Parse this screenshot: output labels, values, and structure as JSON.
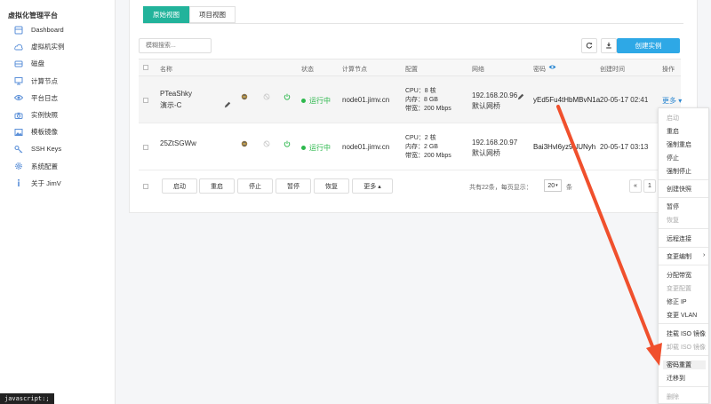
{
  "brand": "虚拟化管理平台",
  "sidebar": {
    "items": [
      {
        "label": "Dashboard",
        "icon": "dashboard-icon"
      },
      {
        "label": "虚拟机实例",
        "icon": "cloud-icon"
      },
      {
        "label": "磁盘",
        "icon": "disk-icon"
      },
      {
        "label": "计算节点",
        "icon": "monitor-icon"
      },
      {
        "label": "平台日志",
        "icon": "eye-icon"
      },
      {
        "label": "实例快照",
        "icon": "camera-icon"
      },
      {
        "label": "模板镜像",
        "icon": "image-icon"
      },
      {
        "label": "SSH Keys",
        "icon": "key-icon"
      },
      {
        "label": "系统配置",
        "icon": "gear-icon"
      },
      {
        "label": "关于 JimV",
        "icon": "info-icon"
      }
    ]
  },
  "tabs": [
    "原始视图",
    "项目视图"
  ],
  "search": {
    "placeholder": "模糊搜索..."
  },
  "toolbar": {
    "create_label": "创建实例"
  },
  "table": {
    "headers": {
      "name": "名称",
      "status": "状态",
      "node": "计算节点",
      "config": "配置",
      "network": "网络",
      "password": "密码",
      "created": "创建时间",
      "action": "操作"
    },
    "rows": [
      {
        "name": "PTeaShky",
        "remark": "演示-C",
        "status": "运行中",
        "node": "node01.jimv.cn",
        "cpu": "CPU：8 核",
        "mem": "内存：8 GB",
        "bw": "带宽：200 Mbps",
        "ip": "192.168.20.96",
        "net": "默认网桥",
        "password": "yEd5Fu4tHbMBvN1a",
        "created": "20-05-17 02:41",
        "action": "更多"
      },
      {
        "name": "25ZtSGWw",
        "remark": "",
        "status": "运行中",
        "node": "node01.jimv.cn",
        "cpu": "CPU：2 核",
        "mem": "内存：2 GB",
        "bw": "带宽：200 Mbps",
        "ip": "192.168.20.97",
        "net": "默认网桥",
        "password": "Bai3Hvl6yz9NUNyh",
        "created": "20-05-17 03:13",
        "action": ""
      }
    ]
  },
  "footer": {
    "buttons": [
      "启动",
      "重启",
      "停止",
      "暂停",
      "恢复",
      "更多"
    ],
    "summary": "共有22条，每页显示：",
    "page_size": "20",
    "unit": "条",
    "pager_prev": "«",
    "pager_current": "1"
  },
  "menu": {
    "items": [
      {
        "label": "启动",
        "disabled": true
      },
      {
        "label": "重启",
        "disabled": false
      },
      {
        "label": "强制重启",
        "disabled": false
      },
      {
        "label": "停止",
        "disabled": false
      },
      {
        "label": "强制停止",
        "disabled": false
      },
      {
        "label": "创建快照",
        "disabled": false
      },
      {
        "label": "暂停",
        "disabled": false
      },
      {
        "label": "恢复",
        "disabled": true
      },
      {
        "label": "远程连接",
        "disabled": false
      },
      {
        "label": "变更编制",
        "disabled": false
      },
      {
        "label": "分配带宽",
        "disabled": false
      },
      {
        "label": "变更配置",
        "disabled": true
      },
      {
        "label": "修正 IP",
        "disabled": false
      },
      {
        "label": "变更 VLAN",
        "disabled": false
      },
      {
        "label": "挂载 ISO 镜像",
        "disabled": false
      },
      {
        "label": "卸载 ISO 镜像",
        "disabled": true
      },
      {
        "label": "密码重置",
        "disabled": false
      },
      {
        "label": "迁移到",
        "disabled": false
      },
      {
        "label": "删除",
        "disabled": true
      }
    ]
  },
  "statusbar": "javascript:;",
  "colors": {
    "accent": "#22b39b",
    "primary": "#2ea8e6",
    "running": "#2db84d",
    "annotation_arrow": "#f0502d"
  }
}
